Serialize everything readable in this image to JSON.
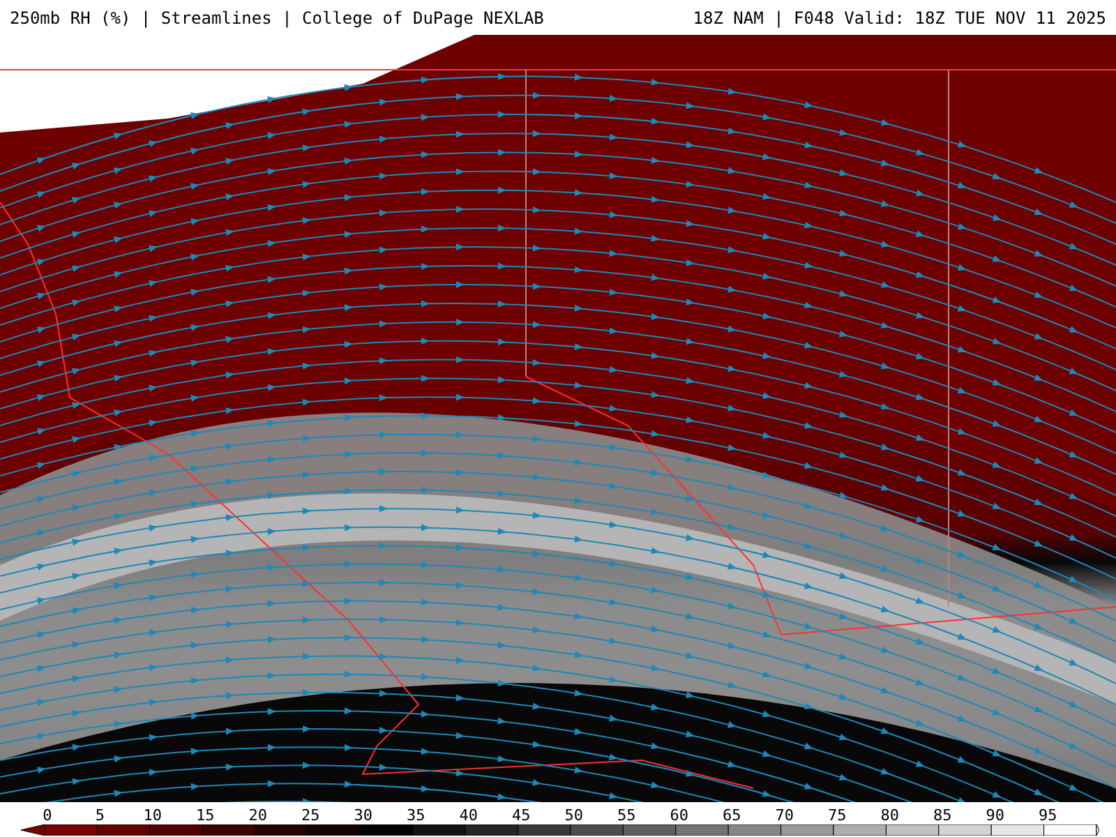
{
  "header": {
    "left": "250mb RH (%) | Streamlines | College of DuPage NEXLAB",
    "right": "18Z NAM | F048 Valid: 18Z TUE NOV 11 2025"
  },
  "colorbar": {
    "labels": [
      "0",
      "5",
      "10",
      "15",
      "20",
      "25",
      "30",
      "35",
      "40",
      "45",
      "50",
      "55",
      "60",
      "65",
      "70",
      "75",
      "80",
      "85",
      "90",
      "95"
    ]
  }
}
